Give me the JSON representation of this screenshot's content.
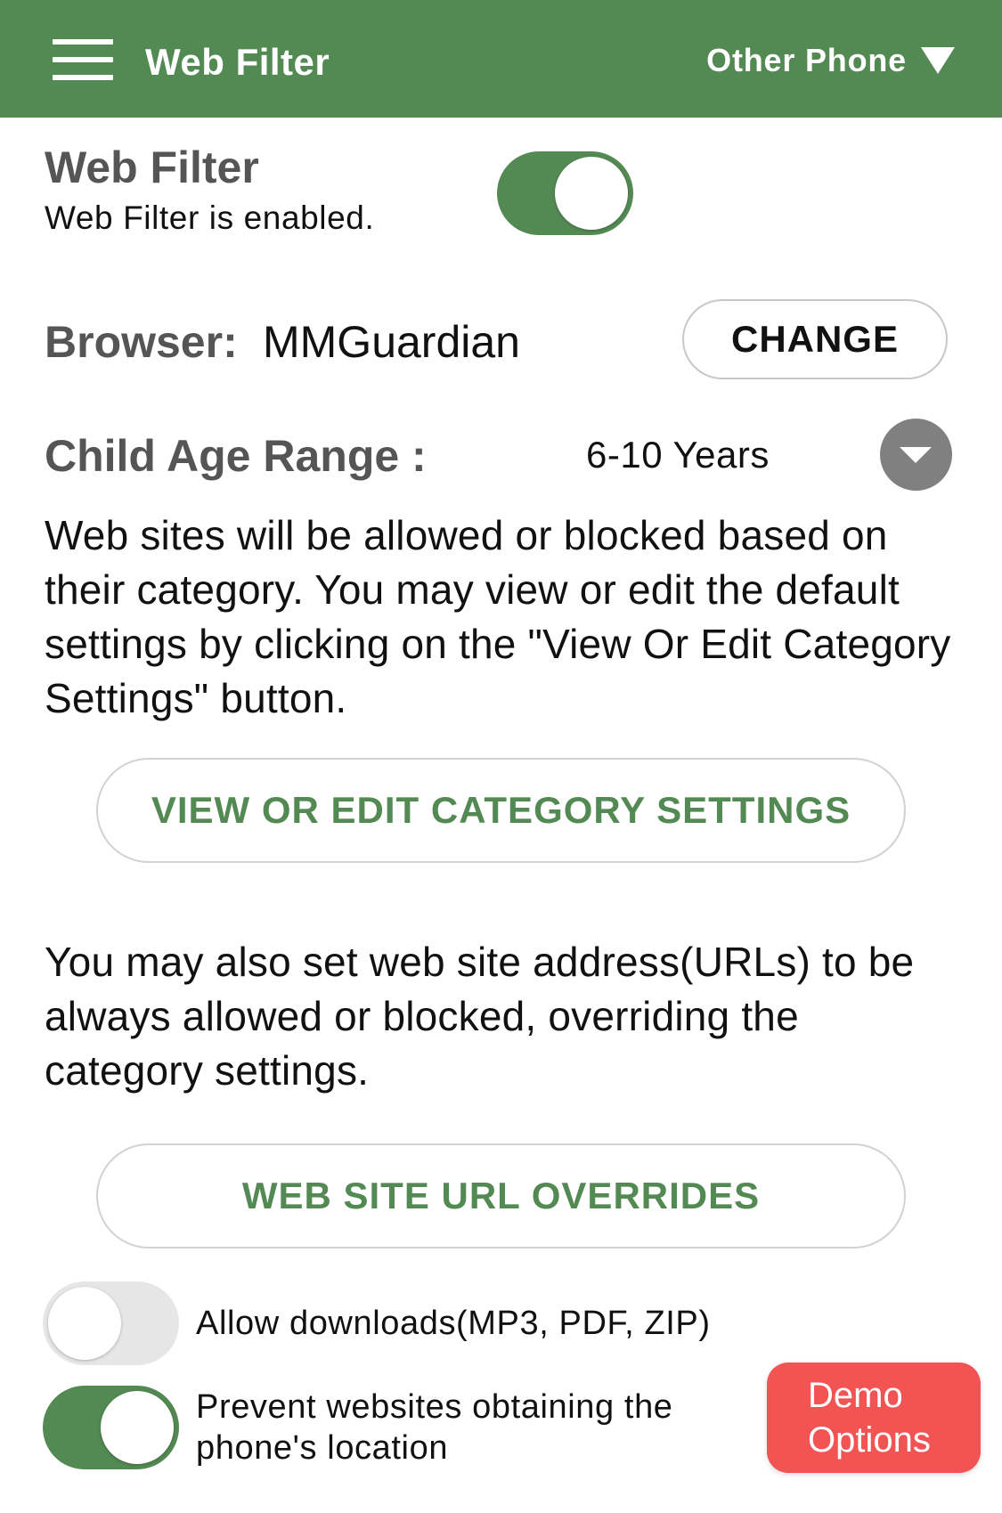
{
  "topbar": {
    "title": "Web Filter",
    "device": "Other Phone",
    "background": "#538953"
  },
  "web_filter": {
    "title": "Web Filter",
    "status": "Web Filter is enabled.",
    "enabled": true
  },
  "browser": {
    "label": "Browser:",
    "value": "MMGuardian",
    "change_label": "CHANGE"
  },
  "age_range": {
    "label": "Child Age Range :",
    "value": "6-10 Years"
  },
  "category_description": "Web sites will be allowed or blocked based on their category. You may view or edit the default settings by clicking on the \"View Or Edit Category Settings\" button.",
  "category_button_label": "VIEW OR EDIT CATEGORY SETTINGS",
  "url_description": "You may also set web site address(URLs) to be always allowed or blocked, overriding the category settings.",
  "url_button_label": "WEB SITE URL OVERRIDES",
  "settings": {
    "allow_downloads": {
      "label": "Allow downloads(MP3, PDF, ZIP)",
      "enabled": false
    },
    "prevent_location": {
      "label": "Prevent websites obtaining the phone's location",
      "enabled": true
    }
  },
  "demo_button": {
    "line1": "Demo",
    "line2": "Options",
    "color": "#f25454"
  },
  "colors": {
    "accent": "#538953",
    "label_gray": "#555555",
    "toggle_off": "#e6e6e6"
  },
  "icons": {
    "menu": "hamburger-menu-icon",
    "device_dropdown": "triangle-down-icon",
    "age_dropdown": "chevron-down-icon"
  }
}
